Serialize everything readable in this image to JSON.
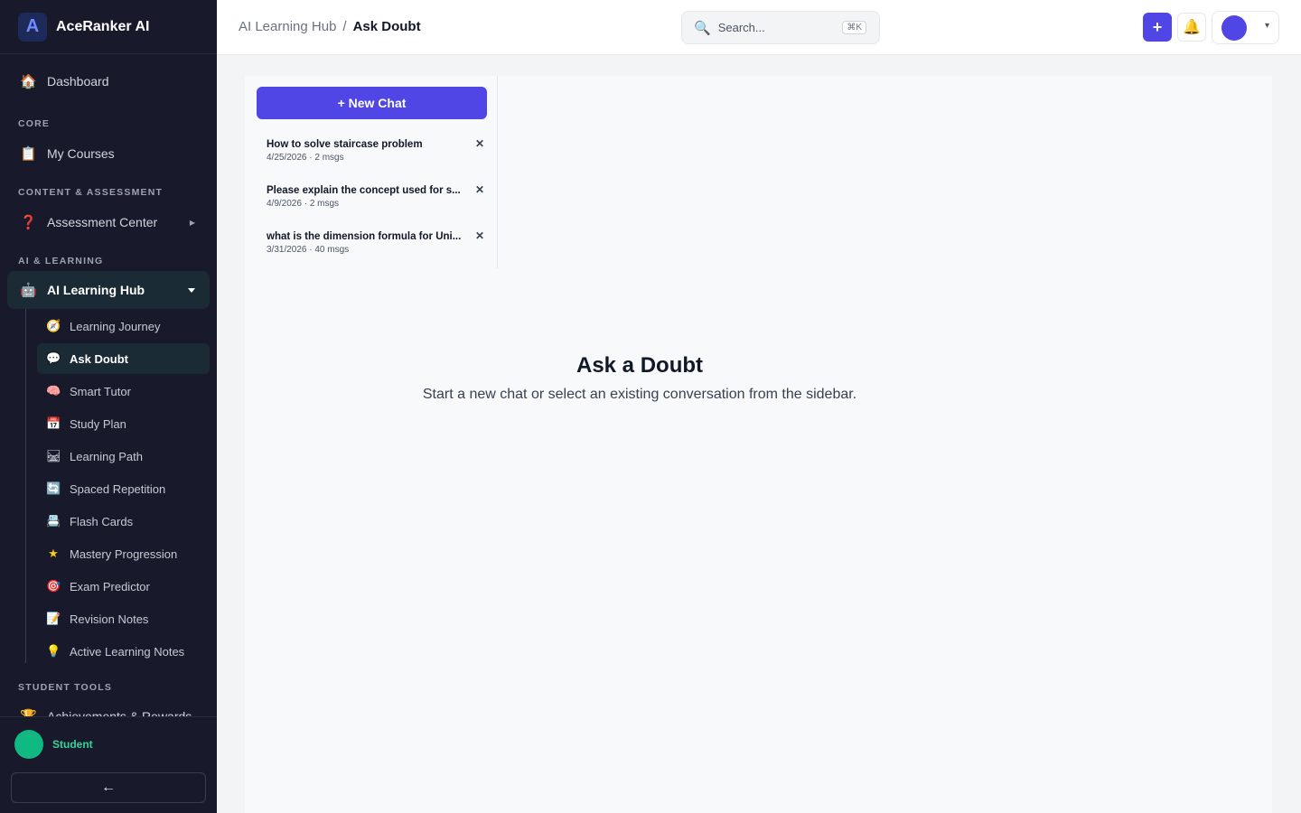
{
  "brand": {
    "logo_glyph": "A",
    "name": "AceRanker AI"
  },
  "nav": {
    "dashboard": {
      "label": "Dashboard",
      "icon": "house-icon"
    },
    "sections": {
      "core": "CORE",
      "content": "CONTENT & ASSESSMENT",
      "ai": "AI & LEARNING",
      "tools": "STUDENT TOOLS"
    },
    "my_courses": {
      "label": "My Courses",
      "icon": "clipboard-icon"
    },
    "assessment_center": {
      "label": "Assessment Center",
      "icon": "question-icon"
    },
    "ai_hub": {
      "label": "AI Learning Hub",
      "icon": "robot-icon"
    },
    "sub_items": [
      {
        "label": "Learning Journey",
        "icon": "compass-icon"
      },
      {
        "label": "Ask Doubt",
        "icon": "speech-bubble-icon"
      },
      {
        "label": "Smart Tutor",
        "icon": "brain-icon"
      },
      {
        "label": "Study Plan",
        "icon": "calendar-icon"
      },
      {
        "label": "Learning Path",
        "icon": "railway-track-icon"
      },
      {
        "label": "Spaced Repetition",
        "icon": "repeat-icon"
      },
      {
        "label": "Flash Cards",
        "icon": "card-file-icon"
      },
      {
        "label": "Mastery Progression",
        "icon": "star-icon"
      },
      {
        "label": "Exam Predictor",
        "icon": "target-icon"
      },
      {
        "label": "Revision Notes",
        "icon": "memo-icon"
      },
      {
        "label": "Active Learning Notes",
        "icon": "light-bulb-icon"
      }
    ],
    "achievements": {
      "label": "Achievements & Rewards",
      "icon": "trophy-icon"
    }
  },
  "user": {
    "role": "Student",
    "avatar_color": "#10b981"
  },
  "collapse_label": "←",
  "header": {
    "breadcrumb_parent": "AI Learning Hub",
    "breadcrumb_sep": "/",
    "breadcrumb_current": "Ask Doubt",
    "search_placeholder": "Search...",
    "search_shortcut": "⌘K",
    "add_label": "+",
    "profile_caret": "▾"
  },
  "chat": {
    "new_chat_label": "+ New Chat",
    "items": [
      {
        "title": "How to solve staircase problem",
        "meta": "4/25/2026 · 2 msgs"
      },
      {
        "title": "Please explain the concept used for s...",
        "meta": "4/9/2026 · 2 msgs"
      },
      {
        "title": "what is the dimension formula for Uni...",
        "meta": "3/31/2026 · 40 msgs"
      }
    ],
    "close_glyph": "✕"
  },
  "empty_state": {
    "title": "Ask a Doubt",
    "subtitle": "Start a new chat or select an existing conversation from the sidebar."
  },
  "colors": {
    "sidebar_bg": "#181a2c",
    "accent": "#4f46e5",
    "active_bg": "#1b2b35",
    "student_green": "#10b981"
  }
}
